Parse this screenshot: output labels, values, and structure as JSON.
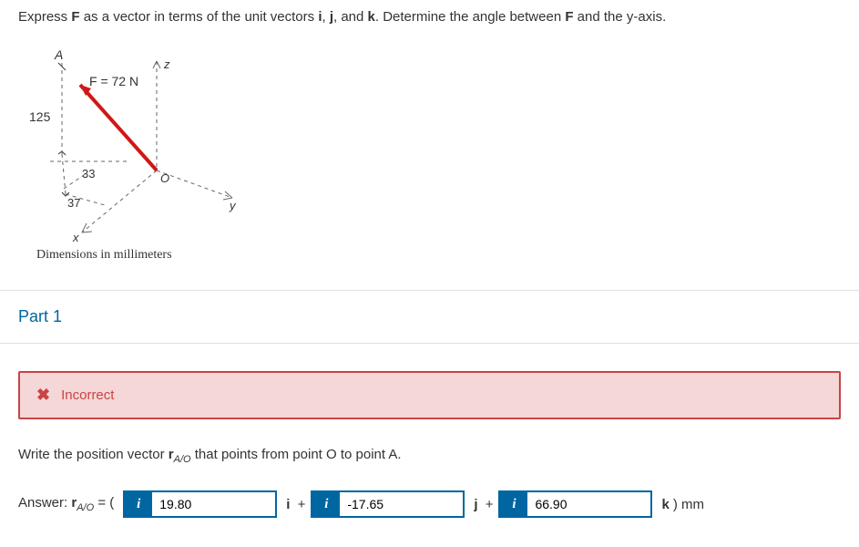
{
  "question": {
    "prefix": "Express ",
    "bold1": "F",
    "mid1": " as a vector in terms of the unit vectors ",
    "bold2": "i",
    "mid2": ", ",
    "bold3": "j",
    "mid3": ", and ",
    "bold4": "k",
    "mid4": ". Determine the angle between ",
    "bold5": "F",
    "suffix": " and the y-axis."
  },
  "diagram": {
    "label_A": "A",
    "label_z": "z",
    "force_label": "F = 72 N",
    "dim_125": "125",
    "dim_33": "33",
    "dim_37": "37",
    "label_O": "O",
    "label_y": "y",
    "label_x": "x",
    "caption": "Dimensions in millimeters"
  },
  "part": {
    "title": "Part 1"
  },
  "feedback": {
    "text": "Incorrect"
  },
  "instruction": {
    "prefix": "Write the position vector ",
    "vec_bold": "r",
    "vec_sub": "A/O",
    "suffix": " that points from point O to point A."
  },
  "answer": {
    "label_prefix": "Answer: ",
    "label_vec": "r",
    "label_sub": "A/O",
    "label_eq": " = ( ",
    "val_i": "19.80",
    "val_j": "-17.65",
    "val_k": "66.90",
    "vec_i": "i",
    "plus1": " + ",
    "vec_j": "j",
    "plus2": " + ",
    "vec_k": "k",
    "close": ") mm",
    "info_icon": "i"
  }
}
